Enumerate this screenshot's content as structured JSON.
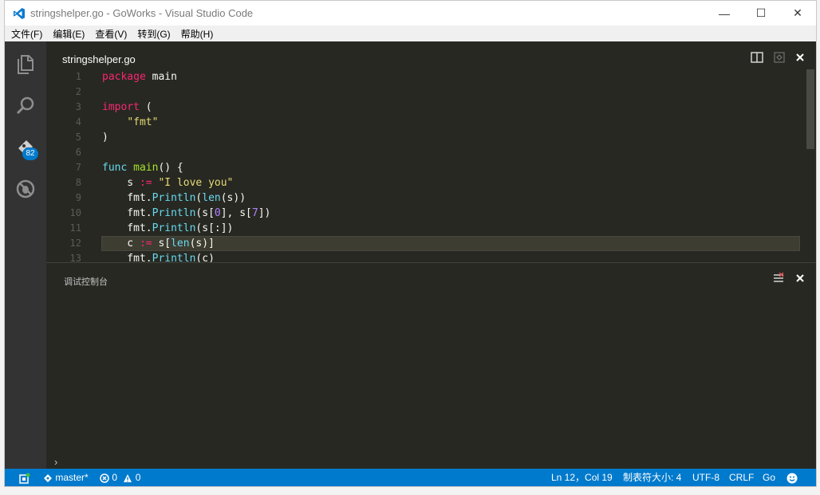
{
  "window": {
    "title": "stringshelper.go - GoWorks - Visual Studio Code",
    "controls": {
      "minimize": "—",
      "maximize": "☐",
      "close": "✕"
    }
  },
  "menu": {
    "items": [
      "文件(F)",
      "编辑(E)",
      "查看(V)",
      "转到(G)",
      "帮助(H)"
    ]
  },
  "activitybar": {
    "icons": [
      "files-icon",
      "search-icon",
      "git-icon",
      "debug-icon"
    ],
    "git_badge": "82"
  },
  "editor": {
    "tab_title": "stringshelper.go",
    "current_line": 12,
    "lines": [
      {
        "n": "1",
        "tokens": [
          [
            "kw",
            "package"
          ],
          [
            "",
            " main"
          ]
        ]
      },
      {
        "n": "2",
        "tokens": []
      },
      {
        "n": "3",
        "tokens": [
          [
            "kw",
            "import"
          ],
          [
            "",
            " ("
          ]
        ]
      },
      {
        "n": "4",
        "tokens": [
          [
            "",
            "    "
          ],
          [
            "str",
            "\"fmt\""
          ]
        ]
      },
      {
        "n": "5",
        "tokens": [
          [
            "",
            ")"
          ]
        ]
      },
      {
        "n": "6",
        "tokens": []
      },
      {
        "n": "7",
        "tokens": [
          [
            "bi",
            "func"
          ],
          [
            "",
            " "
          ],
          [
            "fn",
            "main"
          ],
          [
            "",
            "() {"
          ]
        ]
      },
      {
        "n": "8",
        "tokens": [
          [
            "",
            "    s "
          ],
          [
            "kw",
            ":="
          ],
          [
            "",
            " "
          ],
          [
            "str",
            "\"I love you\""
          ]
        ]
      },
      {
        "n": "9",
        "tokens": [
          [
            "",
            "    fmt."
          ],
          [
            "bi",
            "Println"
          ],
          [
            "",
            "("
          ],
          [
            "bi",
            "len"
          ],
          [
            "",
            "(s))"
          ]
        ]
      },
      {
        "n": "10",
        "tokens": [
          [
            "",
            "    fmt."
          ],
          [
            "bi",
            "Println"
          ],
          [
            "",
            "(s["
          ],
          [
            "num",
            "0"
          ],
          [
            "",
            "], s["
          ],
          [
            "num",
            "7"
          ],
          [
            "",
            "])"
          ]
        ]
      },
      {
        "n": "11",
        "tokens": [
          [
            "",
            "    fmt."
          ],
          [
            "bi",
            "Println"
          ],
          [
            "",
            "(s[:])"
          ]
        ]
      },
      {
        "n": "12",
        "tokens": [
          [
            "",
            "    c "
          ],
          [
            "kw",
            ":="
          ],
          [
            "",
            " s["
          ],
          [
            "bi",
            "len"
          ],
          [
            "",
            "(s)]"
          ]
        ]
      },
      {
        "n": "13",
        "tokens": [
          [
            "",
            "    fmt."
          ],
          [
            "bi",
            "Println"
          ],
          [
            "",
            "(c)"
          ]
        ]
      }
    ]
  },
  "panel": {
    "title": "调试控制台",
    "prompt": "›"
  },
  "statusbar": {
    "branch": "master*",
    "errors": "0",
    "warnings": "0",
    "position": "Ln 12，Col 19",
    "indent": "制表符大小: 4",
    "encoding": "UTF-8",
    "eol": "CRLF",
    "language": "Go"
  },
  "colors": {
    "accent": "#007acc",
    "editor_bg": "#272822",
    "activity_bg": "#333333"
  }
}
